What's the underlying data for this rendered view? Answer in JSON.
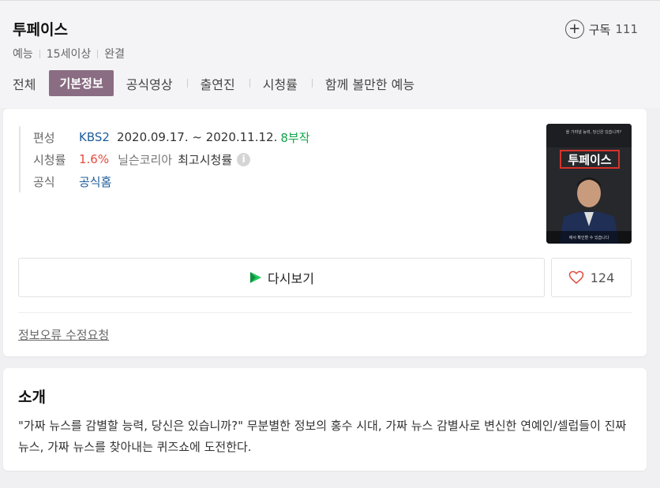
{
  "header": {
    "title": "투페이스",
    "meta": [
      "예능",
      "15세이상",
      "완결"
    ],
    "subscribe_label": "구독",
    "subscribe_count": "111"
  },
  "tabs": [
    "전체",
    "기본정보",
    "공식영상",
    "출연진",
    "시청률",
    "함께 볼만한 예능"
  ],
  "active_tab": "기본정보",
  "info": {
    "broadcast_label": "편성",
    "channel": "KBS2",
    "dates": "2020.09.17. ~ 2020.11.12.",
    "episodes": "8부작",
    "rating_label": "시청률",
    "rating_value": "1.6%",
    "rating_source": "닐슨코리아",
    "rating_note": "최고시청률",
    "official_label": "공식",
    "official_link": "공식홈"
  },
  "poster": {
    "title_text": "투페이스",
    "top_caption": "을 가려낼 능력, 당신은 있습니까?",
    "bottom_caption": "에서 확인할 수 있습니다"
  },
  "actions": {
    "rewatch_label": "다시보기",
    "like_count": "124",
    "report_label": "정보오류 수정요청"
  },
  "intro": {
    "title": "소개",
    "text": "\"가짜 뉴스를 감별할 능력, 당신은 있습니까?\" 무분별한 정보의 홍수 시대, 가짜 뉴스 감별사로 변신한 연예인/셀럽들이 진짜 뉴스, 가짜 뉴스를 찾아내는 퀴즈쇼에 도전한다."
  },
  "colors": {
    "active_tab_bg": "#8a6d83",
    "channel_blue": "#1e5c9b",
    "rating_red": "#e24b3f",
    "episodes_green": "#10a34a",
    "rewatch_icon_green": "#1ec85a"
  }
}
